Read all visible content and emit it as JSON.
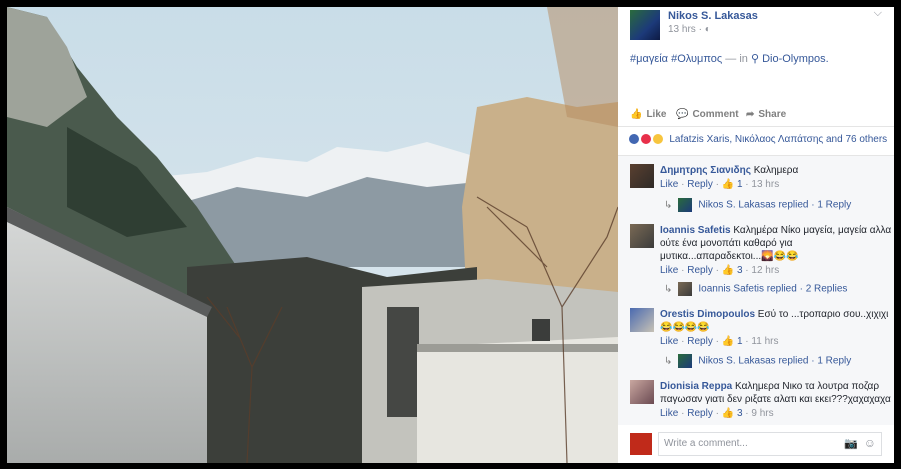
{
  "post": {
    "author": "Nikos S. Lakasas",
    "time": "13 hrs",
    "privacy_icon": "globe-icon",
    "hashtags": "#μαγεία #Ολυμπος",
    "in_text": "— in",
    "location": "Dio-Olympos."
  },
  "actions": {
    "like": "Like",
    "comment": "Comment",
    "share": "Share"
  },
  "reactions": {
    "text": "Lafatzis Xaris, Νικόλαος Λαπάτσης and 76 others"
  },
  "comments": [
    {
      "author": "Δημητρης Σιανιδης",
      "text": "Καλημερα",
      "like": "Like",
      "reply": "Reply",
      "likes": "1",
      "time": "13 hrs"
    },
    {
      "author": "Ioannis Safetis",
      "text": "Καλημέρα Νίκο μαγεία, μαγεία αλλα ούτε ένα μονοπάτι καθαρό για μυτικα...απαραδεκτοι...🌄😂😂",
      "like": "Like",
      "reply": "Reply",
      "likes": "3",
      "time": "12 hrs"
    },
    {
      "author": "Orestis Dimopoulos",
      "text": "Εσύ το ...τροπαριο σου..χιχιχι 😂😂😂😂",
      "like": "Like",
      "reply": "Reply",
      "likes": "1",
      "time": "11 hrs"
    },
    {
      "author": "Dionisia Reppa",
      "text": "Καλημερα Νικο τα λουτρα ποζαρ παγωσαν γιατι δεν ριξατε αλατι και εκει???χαχαχαχα",
      "like": "Like",
      "reply": "Reply",
      "likes": "3",
      "time": "9 hrs"
    }
  ],
  "replies": [
    {
      "name": "Nikos S. Lakasas",
      "suffix": "replied · 1 Reply"
    },
    {
      "name": "Ioannis Safetis",
      "suffix": "replied · 2 Replies"
    },
    {
      "name": "Nikos S. Lakasas",
      "suffix": "replied · 1 Reply"
    }
  ],
  "composer": {
    "placeholder": "Write a comment..."
  }
}
